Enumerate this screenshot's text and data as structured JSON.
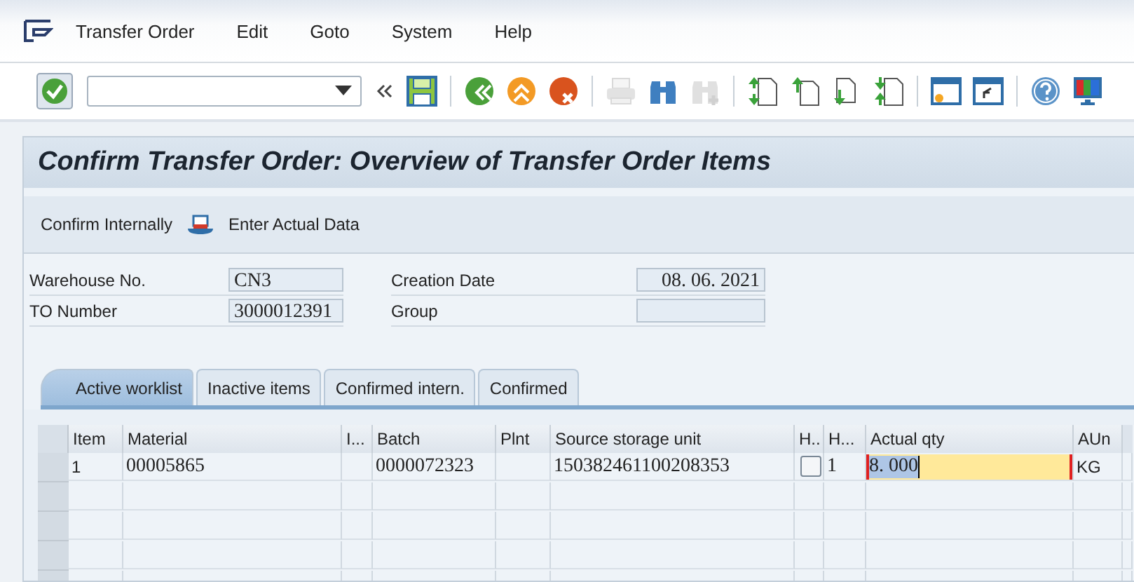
{
  "menu": {
    "items": [
      {
        "label": "Transfer Order"
      },
      {
        "label": "Edit"
      },
      {
        "label": "Goto"
      },
      {
        "label": "System"
      },
      {
        "label": "Help"
      }
    ]
  },
  "toolbar": {
    "buttons": [
      {
        "kind": "enter",
        "disabled": false
      },
      {
        "kind": "back-arrows",
        "disabled": false
      },
      {
        "kind": "save",
        "disabled": false
      },
      {
        "kind": "back",
        "disabled": false
      },
      {
        "kind": "exit",
        "disabled": false
      },
      {
        "kind": "cancel",
        "disabled": false
      },
      {
        "kind": "print",
        "disabled": true
      },
      {
        "kind": "find",
        "disabled": false
      },
      {
        "kind": "find-next",
        "disabled": true
      },
      {
        "kind": "first-page",
        "disabled": false
      },
      {
        "kind": "prev-page",
        "disabled": false
      },
      {
        "kind": "next-page",
        "disabled": false
      },
      {
        "kind": "last-page",
        "disabled": false
      },
      {
        "kind": "new-session",
        "disabled": false
      },
      {
        "kind": "shortcut",
        "disabled": false
      },
      {
        "kind": "help",
        "disabled": false
      },
      {
        "kind": "layout",
        "disabled": false
      }
    ]
  },
  "window": {
    "title": "Confirm Transfer Order: Overview of Transfer Order Items"
  },
  "app_toolbar": {
    "buttons": [
      {
        "label": "Confirm Internally",
        "kind": "text"
      },
      {
        "label": "Enter Actual Data",
        "kind": "icon"
      }
    ]
  },
  "header": {
    "left": [
      {
        "label": "Warehouse No.",
        "value": "CN3"
      },
      {
        "label": "TO Number",
        "value": "3000012391"
      }
    ],
    "right": [
      {
        "label": "Creation Date",
        "value": "08. 06. 2021"
      },
      {
        "label": "Group"
      }
    ]
  },
  "tabs": [
    {
      "label": "Active worklist",
      "selected": true
    },
    {
      "label": "Inactive items",
      "selected": false
    },
    {
      "label": "Confirmed intern.",
      "selected": false
    },
    {
      "label": "Confirmed",
      "selected": false
    }
  ],
  "table": {
    "columns": [
      "Item",
      "Material",
      "I...",
      "Batch",
      "Plnt",
      "Source storage unit",
      "H..",
      "H...",
      "Actual qty",
      "AUn"
    ],
    "rows": [
      {
        "item": "1",
        "material": "00005865",
        "batch": "0000072323",
        "source_storage_unit": "150382461100208353",
        "h_checkbox": {
          "checked": false
        },
        "h": "1",
        "actual_qty": "8. 000",
        "aun": "KG"
      }
    ]
  }
}
